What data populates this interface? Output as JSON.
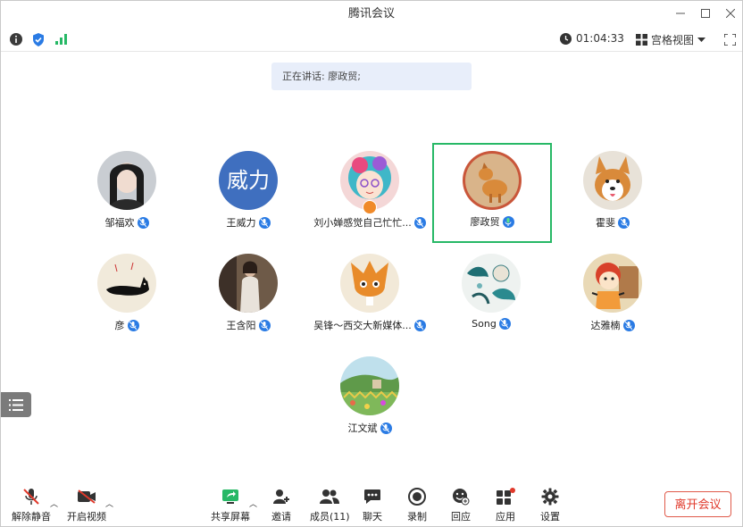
{
  "window": {
    "title": "腾讯会议"
  },
  "top": {
    "timer": "01:04:33",
    "view_label": "宫格视图"
  },
  "speaking": {
    "label": "正在讲话: 廖政贸;"
  },
  "participants": [
    {
      "name": "邹福欢"
    },
    {
      "name": "王威力",
      "avatar_text": "威力"
    },
    {
      "name": "刘小婵感觉自己忙忙..."
    },
    {
      "name": "廖政贸"
    },
    {
      "name": "霍斐"
    },
    {
      "name": "彦"
    },
    {
      "name": "王含阳"
    },
    {
      "name": "吴锋～西交大新媒体..."
    },
    {
      "name": "Song"
    },
    {
      "name": "达雅楠"
    },
    {
      "name": "江文斌"
    }
  ],
  "toolbar": {
    "unmute": "解除静音",
    "start_video": "开启视频",
    "share_screen": "共享屏幕",
    "invite": "邀请",
    "members": "成员(11)",
    "chat": "聊天",
    "record": "录制",
    "replay": "回应",
    "apps": "应用",
    "settings": "设置",
    "leave": "离开会议"
  },
  "colors": {
    "accent": "#2a7be4",
    "active_border": "#27b866",
    "leave": "#e0392b"
  }
}
